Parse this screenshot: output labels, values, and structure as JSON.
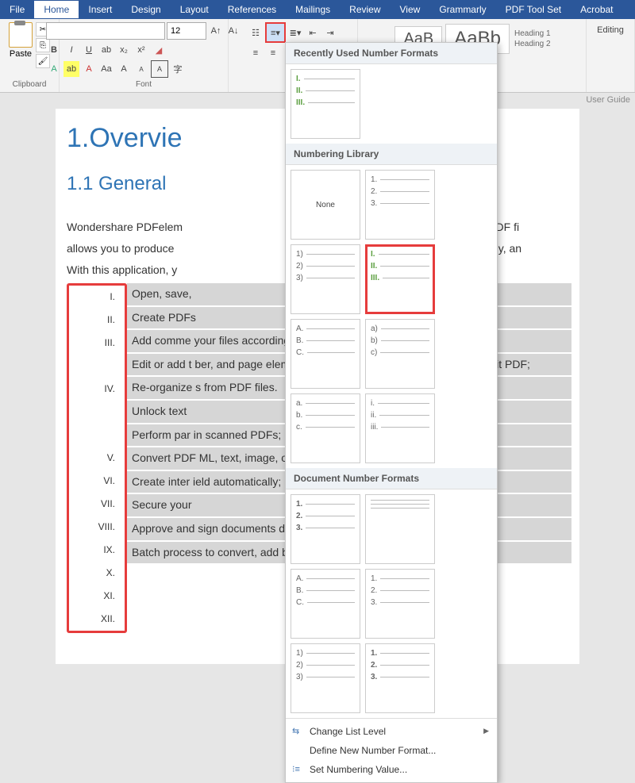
{
  "tabs": {
    "file": "File",
    "home": "Home",
    "insert": "Insert",
    "design": "Design",
    "layout": "Layout",
    "references": "References",
    "mailings": "Mailings",
    "review": "Review",
    "view": "View",
    "grammarly": "Grammarly",
    "pdf": "PDF Tool Set",
    "acrobat": "Acrobat"
  },
  "ribbon": {
    "paste": "Paste",
    "clipboard": "Clipboard",
    "font": "Font",
    "fontSize": "12",
    "styles": {
      "normal": "AaBb",
      "h1": "Heading 1",
      "h2": "Heading 2",
      "aab": "AaB"
    },
    "editing": "Editing"
  },
  "dropdown": {
    "recent": "Recently Used Number Formats",
    "library": "Numbering Library",
    "none": "None",
    "docfmt": "Document Number Formats",
    "changeLevel": "Change List Level",
    "defineNew": "Define New Number Format...",
    "setValue": "Set Numbering Value..."
  },
  "doc": {
    "userGuide": "User Guide",
    "h1": "1.Overvie",
    "h2": "1.1 General",
    "p1": "Wondershare PDFelem",
    "p1b": "nake working with PDF fi",
    "p2": "allows you to produce",
    "p2b": "ms quickly, affordably, an",
    "p3": "With this application, y",
    "romans": [
      "I.",
      "II.",
      "III.",
      "",
      "IV.",
      "",
      "",
      "V.",
      "VI.",
      "VII.",
      "VIII.",
      "IX.",
      "X.",
      "XI.",
      "XII."
    ],
    "items": [
      "Open, save,",
      "Create PDFs",
      "Add comme                                                                your files according to your require",
      "Edit or add t                                                               ber, and page elements PDF and add                                                            ny graphical element wit PDF;",
      "Re-organize                                                               s from PDF files.",
      "Unlock text",
      "Perform par                                                               in scanned PDFs;",
      "Convert PDF                                                              ML, text, image, or othe",
      "Create inter                                                               ield automatically;",
      "Secure your",
      "Approve and sign documents digitally;",
      "Batch process to convert, add bates number and watermark to your files."
    ]
  }
}
